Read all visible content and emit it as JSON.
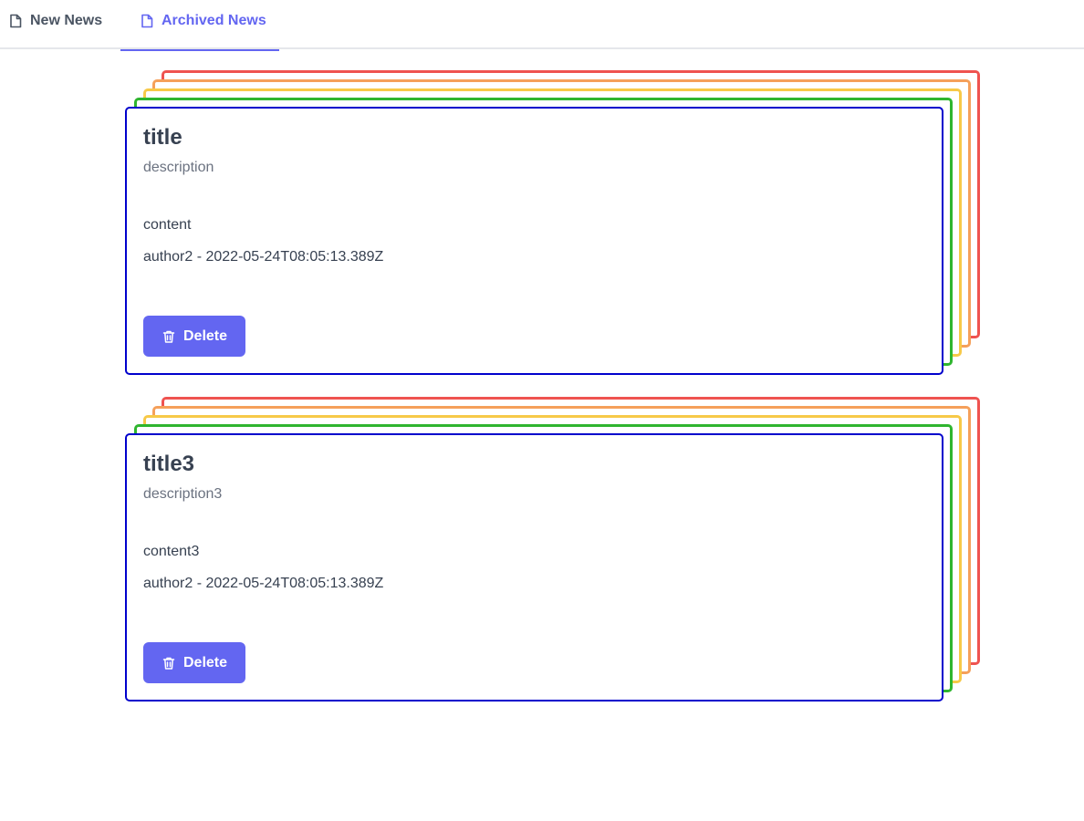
{
  "tabs": [
    {
      "label": "New News",
      "icon": "document-icon",
      "active": false
    },
    {
      "label": "Archived News",
      "icon": "document-icon",
      "active": true
    }
  ],
  "colors": {
    "accent": "#6366f1",
    "card_border": "#0000cc",
    "stack_red": "#ef5350",
    "stack_orange": "#f5a05a",
    "stack_yellow": "#f7c948",
    "stack_green": "#2fb52f"
  },
  "news": [
    {
      "title": "title",
      "description": "description",
      "content": "content",
      "author": "author2",
      "date": "2022-05-24T08:05:13.389Z",
      "delete_label": "Delete",
      "delete_icon": "trash-icon"
    },
    {
      "title": "title3",
      "description": "description3",
      "content": "content3",
      "author": "author2",
      "date": "2022-05-24T08:05:13.389Z",
      "delete_label": "Delete",
      "delete_icon": "trash-icon"
    }
  ]
}
